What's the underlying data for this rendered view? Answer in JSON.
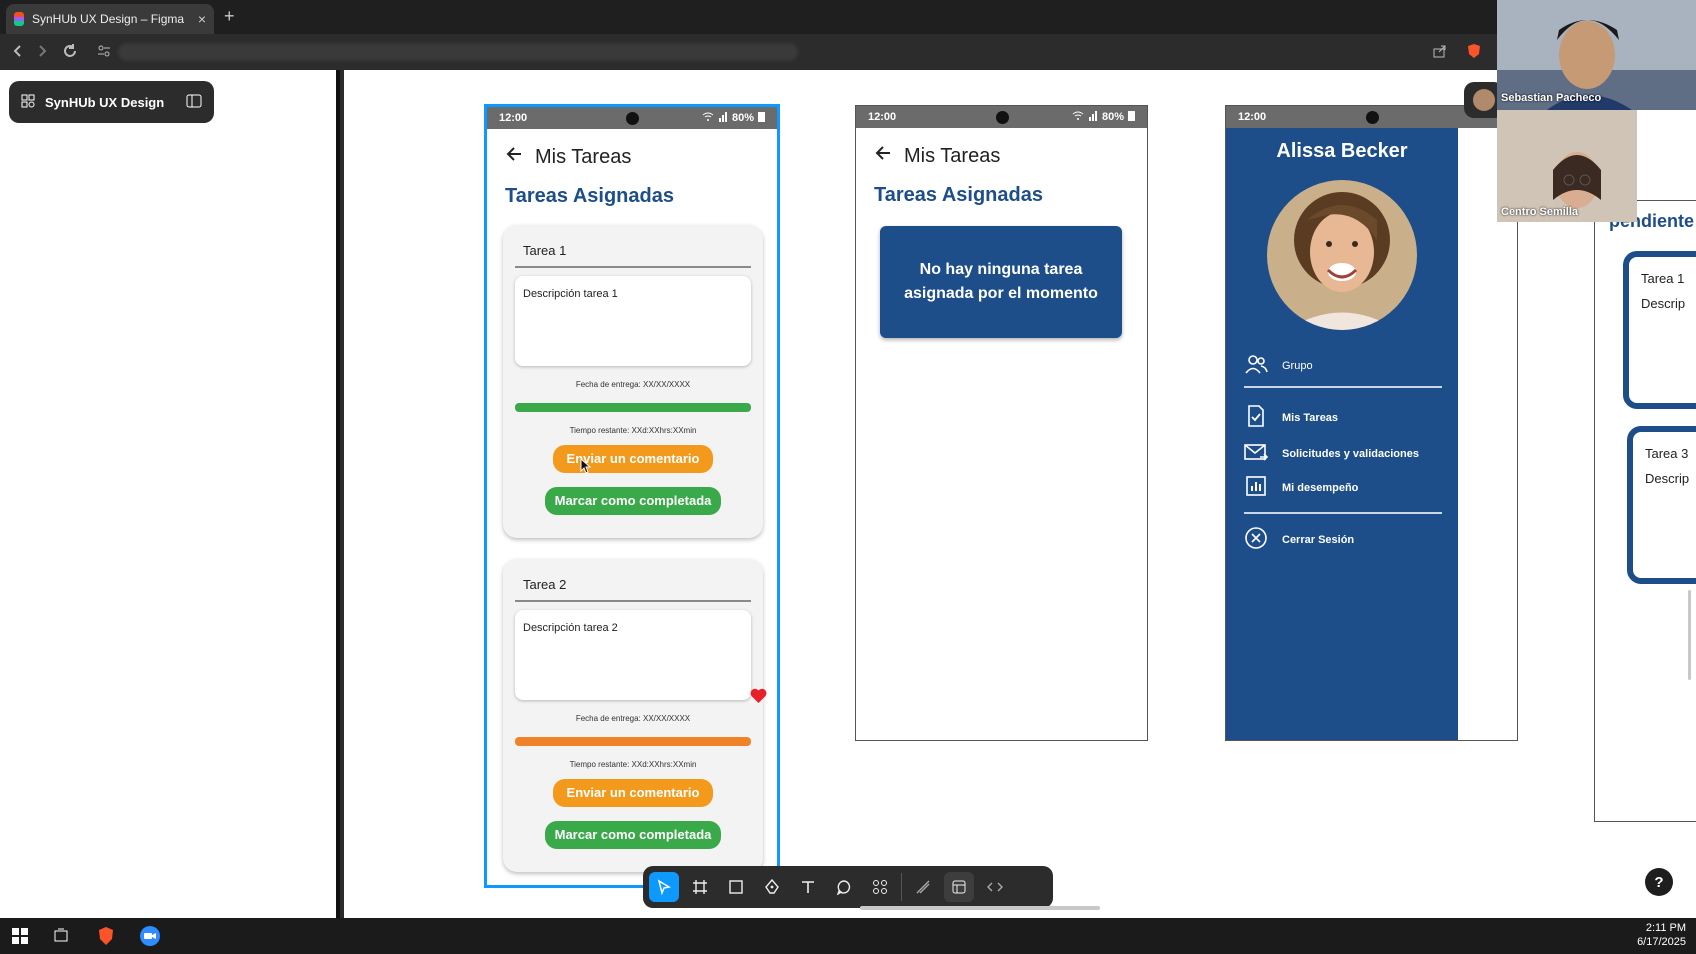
{
  "browser": {
    "tab_title": "SynHUb UX Design – Figma",
    "close_glyph": "×",
    "new_tab_glyph": "+"
  },
  "figma": {
    "file_name": "SynHUb UX Design",
    "toolbar_tools": [
      "move-tool",
      "frame-tool",
      "rectangle-tool",
      "pen-tool",
      "text-tool",
      "comment-tool",
      "actions-tool",
      "draw-mode",
      "design-mode",
      "dev-mode"
    ]
  },
  "screen1": {
    "time": "12:00",
    "battery": "80%",
    "title": "Mis Tareas",
    "subtitle": "Tareas Asignadas",
    "tasks": [
      {
        "title": "Tarea 1",
        "description": "Descripción tarea 1",
        "due": "Fecha de entrega: XX/XX/XXXX",
        "remaining": "Tiempo restante: XXd:XXhrs:XXmin",
        "bar_color": "#3aa94a",
        "comment_button": "Enviar un comentario",
        "complete_button": "Marcar como completada"
      },
      {
        "title": "Tarea 2",
        "description": "Descripción tarea 2",
        "due": "Fecha de entrega: XX/XX/XXXX",
        "remaining": "Tiempo restante: XXd:XXhrs:XXmin",
        "bar_color": "#f0822a",
        "comment_button": "Enviar un comentario",
        "complete_button": "Marcar como completada"
      }
    ]
  },
  "screen2": {
    "time": "12:00",
    "battery": "80%",
    "title": "Mis Tareas",
    "subtitle": "Tareas Asignadas",
    "empty_message": "No hay ninguna tarea asignada por el momento"
  },
  "screen3": {
    "time": "12:00",
    "user_name": "Alissa Becker",
    "menu": {
      "group": "Grupo",
      "tasks": "Mis Tareas",
      "requests": "Solicitudes y validaciones",
      "performance": "Mi desempeño",
      "logout": "Cerrar Sesión"
    }
  },
  "screen4_partial": {
    "heading_fragment": "pendiente",
    "task_a": "Tarea 1",
    "task_a_desc": "Descrip",
    "task_b": "Tarea 3",
    "task_b_desc": "Descrip"
  },
  "call": {
    "participant1": "Sebastian Pacheco",
    "participant2": "Centro Semilla"
  },
  "help_glyph": "?",
  "taskbar": {
    "time": "2:11 PM",
    "date": "6/17/2025"
  },
  "colors": {
    "primary_blue": "#1d4e89",
    "orange": "#f39a1d",
    "green": "#3aa94a",
    "figma_selection": "#0d99ff"
  }
}
